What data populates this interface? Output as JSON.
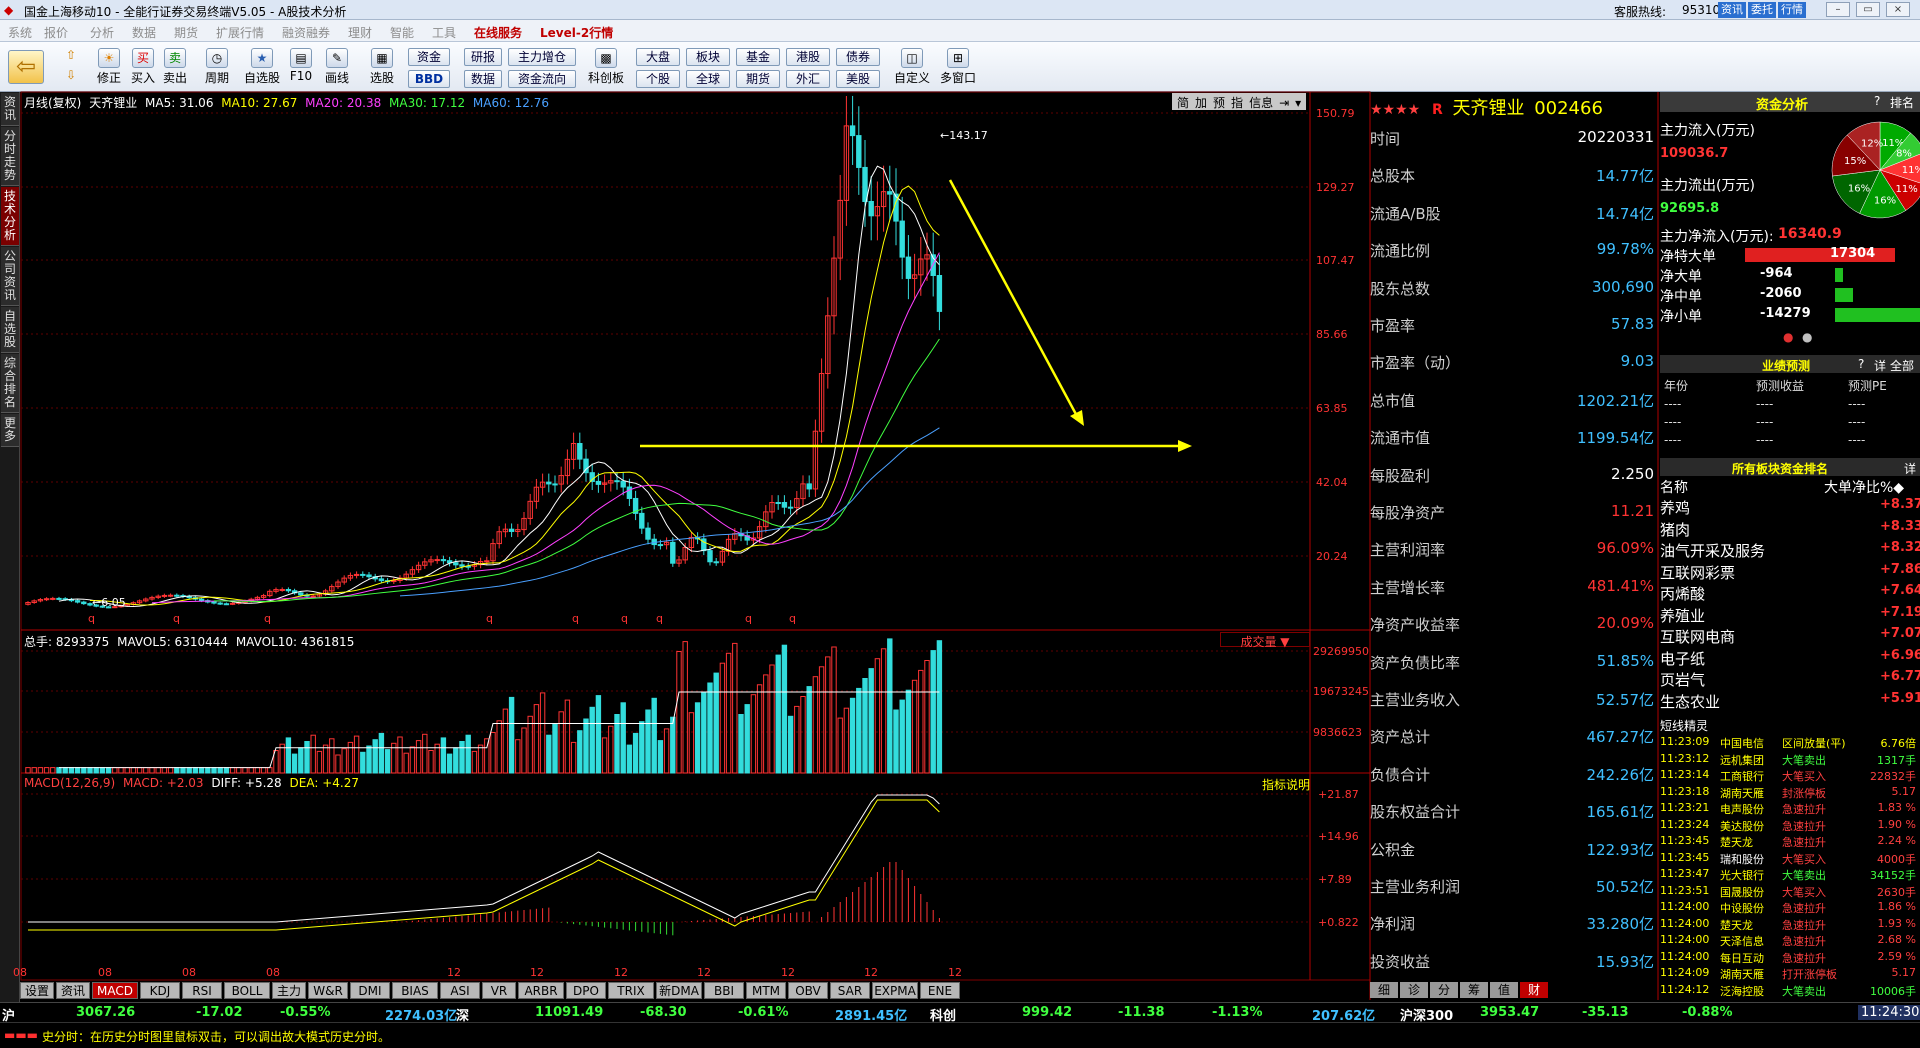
{
  "window": {
    "title": "国金上海移动10 - 全能行证券交易终端V5.05 - A股技术分析",
    "hotline_label": "客服热线:",
    "hotline": "95310",
    "tabs": [
      "资讯",
      "委托",
      "行情"
    ],
    "controls": [
      "–",
      "▭",
      "×"
    ]
  },
  "menu": [
    "系统",
    "报价",
    "分析",
    "数据",
    "期货",
    "扩展行情",
    "融资融券",
    "理财",
    "智能",
    "工具",
    "在线服务",
    "Level-2行情"
  ],
  "toolbar": {
    "buttons": [
      "修正",
      "买入",
      "卖出",
      "周期",
      "自选股",
      "F10",
      "画线",
      "选股",
      "科创板",
      "自定义",
      "多窗口"
    ],
    "small_buttons": [
      "资金",
      "研报",
      "主力增仓",
      "BBD",
      "数据",
      "资金流向",
      "大盘",
      "板块",
      "基金",
      "港股",
      "债券",
      "个股",
      "全球",
      "期货",
      "外汇",
      "美股"
    ]
  },
  "leftnav": [
    "资讯",
    "分时走势",
    "技术分析",
    "公司资讯",
    "自选股",
    "综合排名",
    "更多"
  ],
  "chart_header": {
    "text": "月线(复权)",
    "name": "天齐锂业",
    "ma5": "MA5: 31.06",
    "ma10": "MA10: 27.67",
    "ma20": "MA20: 20.38",
    "ma30": "MA30: 17.12",
    "ma60": "MA60: 12.76"
  },
  "chart_icons": [
    "简",
    "加",
    "预",
    "指",
    "信息",
    "⇥",
    "▾"
  ],
  "vol_header": {
    "total": "总手: 8293375",
    "mavol5": "MAVOL5: 6310444",
    "mavol10": "MAVOL10: 4361815",
    "dropdown": "成交量"
  },
  "macd_header": {
    "title": "MACD(12,26,9)",
    "macd": "MACD: +2.03",
    "diff": "DIFF: +5.28",
    "dea": "DEA: +4.27",
    "help": "指标说明"
  },
  "chart_data": {
    "type": "candlestick",
    "price_ticks": [
      "150.79",
      "129.27",
      "107.47",
      "85.66",
      "63.85",
      "42.04",
      "20.24"
    ],
    "max_label": "143.17",
    "min_label": "6.05",
    "vol_ticks": [
      "29269950",
      "19673245",
      "9836623"
    ],
    "macd_ticks": [
      "+21.87",
      "+14.96",
      "+7.89",
      "+0.822"
    ],
    "x_ticks": [
      "08",
      "08",
      "08",
      "08",
      "12",
      "12",
      "12",
      "12",
      "12",
      "12",
      "12"
    ],
    "q_marks": [
      "q",
      "q",
      "q",
      "q",
      "q",
      "q",
      "q",
      "q",
      "q",
      "q"
    ]
  },
  "indicator_tabs": [
    "设置",
    "资讯",
    "MACD",
    "KDJ",
    "RSI",
    "BOLL",
    "主力",
    "W&R",
    "DMI",
    "BIAS",
    "ASI",
    "VR",
    "ARBR",
    "DPO",
    "TRIX",
    "新DMA",
    "BBI",
    "MTM",
    "OBV",
    "SAR",
    "EXPMA",
    "ENE"
  ],
  "stock": {
    "stars": "★★★★",
    "badge": "R",
    "name": "天齐锂业",
    "code": "002466"
  },
  "fin": [
    [
      "时间",
      "20220331"
    ],
    [
      "总股本",
      "14.77亿"
    ],
    [
      "流通A/B股",
      "14.74亿"
    ],
    [
      "流通比例",
      "99.78%"
    ],
    [
      "股东总数",
      "300,690"
    ],
    [
      "市盈率",
      "57.83"
    ],
    [
      "市盈率（动）",
      "9.03"
    ],
    [
      "总市值",
      "1202.21亿"
    ],
    [
      "流通市值",
      "1199.54亿"
    ],
    [
      "每股盈利",
      "2.250"
    ],
    [
      "每股净资产",
      "11.21"
    ],
    [
      "主营利润率",
      "96.09%"
    ],
    [
      "主营增长率",
      "481.41%"
    ],
    [
      "净资产收益率",
      "20.09%"
    ],
    [
      "资产负债比率",
      "51.85%"
    ],
    [
      "主营业务收入",
      "52.57亿"
    ],
    [
      "资产总计",
      "467.27亿"
    ],
    [
      "负债合计",
      "242.26亿"
    ],
    [
      "股东权益合计",
      "165.61亿"
    ],
    [
      "公积金",
      "122.93亿"
    ],
    [
      "主营业务利润",
      "50.52亿"
    ],
    [
      "净利润",
      "33.280亿"
    ],
    [
      "投资收益",
      "15.93亿"
    ]
  ],
  "fin_tabs": [
    "细",
    "诊",
    "分",
    "筹",
    "值",
    "财"
  ],
  "capital": {
    "title": "资金分析",
    "q": "?",
    "rank": "排名",
    "in_label": "主力流入(万元)",
    "in_val": "109036.7",
    "out_label": "主力流出(万元)",
    "out_val": "92695.8",
    "net_label": "主力净流入(万元):",
    "net_val": "16340.9",
    "rows": [
      [
        "净特大单",
        "17304"
      ],
      [
        "净大单",
        "-964"
      ],
      [
        "净中单",
        "-2060"
      ],
      [
        "净小单",
        "-14279"
      ]
    ],
    "pie_labels": [
      "11%",
      "8%",
      "11%",
      "11%",
      "16%",
      "16%",
      "15%",
      "12%"
    ]
  },
  "forecast": {
    "title": "业绩预测",
    "q": "?",
    "detail": "详",
    "all": "全部",
    "headers": [
      "年份",
      "预测收益",
      "预测PE"
    ],
    "rows": [
      [
        "----",
        "----",
        "----"
      ],
      [
        "----",
        "----",
        "----"
      ],
      [
        "----",
        "----",
        "----"
      ]
    ]
  },
  "sector": {
    "title": "所有板块资金排名",
    "detail": "详",
    "h1": "名称",
    "h2": "大单净比%◆",
    "rows": [
      [
        "养鸡",
        "+8.37"
      ],
      [
        "猪肉",
        "+8.33"
      ],
      [
        "油气开采及服务",
        "+8.32"
      ],
      [
        "互联网彩票",
        "+7.86"
      ],
      [
        "丙烯酸",
        "+7.64"
      ],
      [
        "养殖业",
        "+7.19"
      ],
      [
        "互联网电商",
        "+7.07"
      ],
      [
        "电子纸",
        "+6.96"
      ],
      [
        "页岩气",
        "+6.77"
      ],
      [
        "生态农业",
        "+5.91"
      ]
    ]
  },
  "short": {
    "title": "短线精灵",
    "rows": [
      [
        "11:23:09",
        "中国电信",
        "区间放量(平)",
        "6.76倍"
      ],
      [
        "11:23:12",
        "远机集团",
        "大笔卖出",
        "1317手"
      ],
      [
        "11:23:14",
        "工商银行",
        "大笔买入",
        "22832手"
      ],
      [
        "11:23:18",
        "湖南天雁",
        "封涨停板",
        "5.17"
      ],
      [
        "11:23:21",
        "电声股份",
        "急速拉升",
        "1.83 %"
      ],
      [
        "11:23:24",
        "美达股份",
        "急速拉升",
        "1.90 %"
      ],
      [
        "11:23:45",
        "楚天龙",
        "急速拉升",
        "2.24 %"
      ],
      [
        "11:23:45",
        "瑞和股份",
        "大笔买入",
        "4000手"
      ],
      [
        "11:23:47",
        "光大银行",
        "大笔卖出",
        "34152手"
      ],
      [
        "11:23:51",
        "国晟股份",
        "大笔买入",
        "2630手"
      ],
      [
        "11:24:00",
        "中设股份",
        "急速拉升",
        "1.86 %"
      ],
      [
        "11:24:00",
        "楚天龙",
        "急速拉升",
        "1.93 %"
      ],
      [
        "11:24:00",
        "天泽信息",
        "急速拉升",
        "2.68 %"
      ],
      [
        "11:24:00",
        "每日互动",
        "急速拉升",
        "2.59 %"
      ],
      [
        "11:24:09",
        "湖南天雁",
        "打开涨停板",
        "5.17"
      ],
      [
        "11:24:12",
        "泛海控股",
        "大笔卖出",
        "10006手"
      ]
    ]
  },
  "bottom": {
    "items": [
      "沪",
      "3067.26",
      "-17.02",
      "-0.55%",
      "2274.03亿",
      "深",
      "11091.49",
      "-68.30",
      "-0.61%",
      "2891.45亿",
      "科创",
      "999.42",
      "-11.38",
      "-1.13%",
      "207.62亿",
      "沪深300",
      "3953.47",
      "-35.13",
      "-0.88%"
    ],
    "time": "11:24:30"
  },
  "marquee": "史分时：在历史分时图里鼠标双击，可以调出故大模式历史分时。",
  "colors": {
    "up": "#ff3333",
    "down": "#33dddd",
    "yellow": "#ffff00",
    "bg": "#000000",
    "grid": "#800000"
  }
}
